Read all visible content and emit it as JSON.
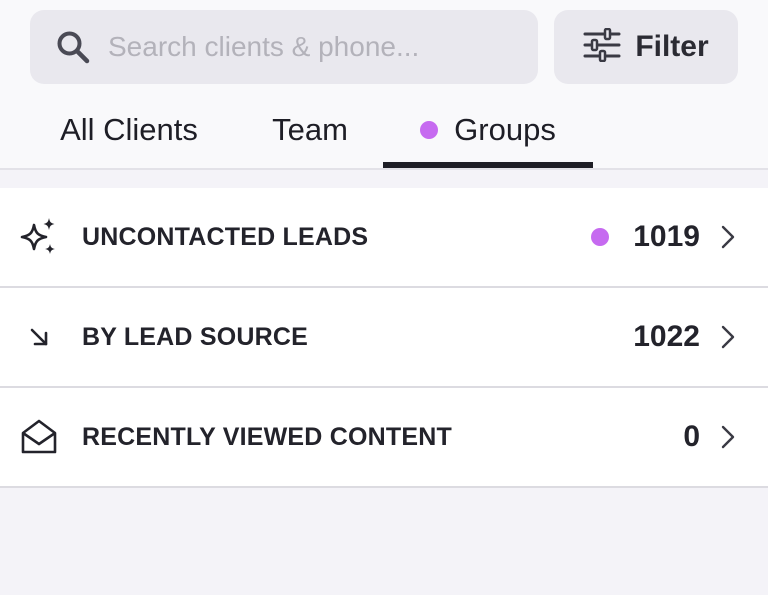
{
  "search": {
    "placeholder": "Search clients & phone..."
  },
  "filter": {
    "label": "Filter"
  },
  "tabs": [
    {
      "label": "All Clients"
    },
    {
      "label": "Team"
    },
    {
      "label": "Groups"
    }
  ],
  "colors": {
    "accent_dot": "#c66af0",
    "text": "#23232b",
    "muted": "#b3b2ba"
  },
  "groups": [
    {
      "title": "UNCONTACTED LEADS",
      "count": "1019",
      "icon": "sparkles-icon"
    },
    {
      "title": "BY LEAD SOURCE",
      "count": "1022",
      "icon": "arrow-down-right-icon"
    },
    {
      "title": "RECENTLY VIEWED CONTENT",
      "count": "0",
      "icon": "open-envelope-icon"
    }
  ]
}
